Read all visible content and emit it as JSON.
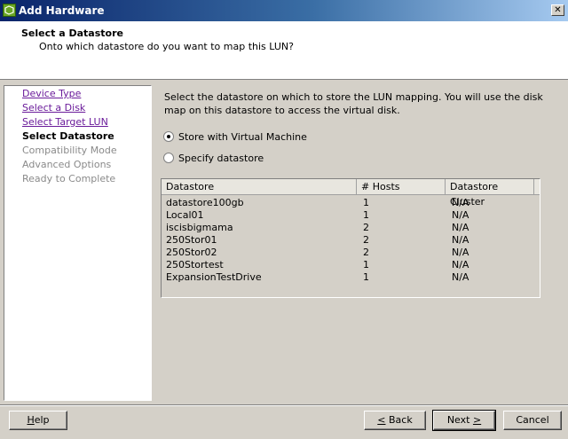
{
  "window": {
    "title": "Add Hardware",
    "close_glyph": "✕"
  },
  "header": {
    "title": "Select a Datastore",
    "subtitle": "Onto which datastore do you want to map this LUN?"
  },
  "steps": [
    {
      "label": "Device Type",
      "state": "done"
    },
    {
      "label": "Select a Disk",
      "state": "done"
    },
    {
      "label": "Select Target LUN",
      "state": "done"
    },
    {
      "label": "Select Datastore",
      "state": "current"
    },
    {
      "label": "Compatibility Mode",
      "state": "future"
    },
    {
      "label": "Advanced Options",
      "state": "future"
    },
    {
      "label": "Ready to Complete",
      "state": "future"
    }
  ],
  "content": {
    "instructions": "Select the datastore on which to store the LUN mapping. You will use the disk map on this datastore to access the virtual disk.",
    "options": [
      {
        "label": "Store with Virtual Machine",
        "checked": true
      },
      {
        "label": "Specify datastore",
        "checked": false
      }
    ]
  },
  "table": {
    "columns": [
      "Datastore",
      "# Hosts",
      "Datastore Cluster"
    ],
    "rows": [
      [
        "datastore100gb",
        "1",
        "N/A"
      ],
      [
        "Local01",
        "1",
        "N/A"
      ],
      [
        "iscisbigmama",
        "2",
        "N/A"
      ],
      [
        "250Stor01",
        "2",
        "N/A"
      ],
      [
        "250Stor02",
        "2",
        "N/A"
      ],
      [
        "250Stortest",
        "1",
        "N/A"
      ],
      [
        "ExpansionTestDrive",
        "1",
        "N/A"
      ]
    ]
  },
  "buttons": {
    "help": {
      "pre": "",
      "key": "H",
      "post": "elp"
    },
    "back": {
      "pre": "",
      "key": "<",
      "post": " Back"
    },
    "next": {
      "pre": "Next ",
      "key": ">",
      "post": ""
    },
    "cancel": {
      "pre": "Cancel",
      "key": "",
      "post": ""
    }
  },
  "colors": {
    "link": "#6a1b9a",
    "disabled": "#8a8a8a",
    "titlebar": "#0a246a"
  }
}
